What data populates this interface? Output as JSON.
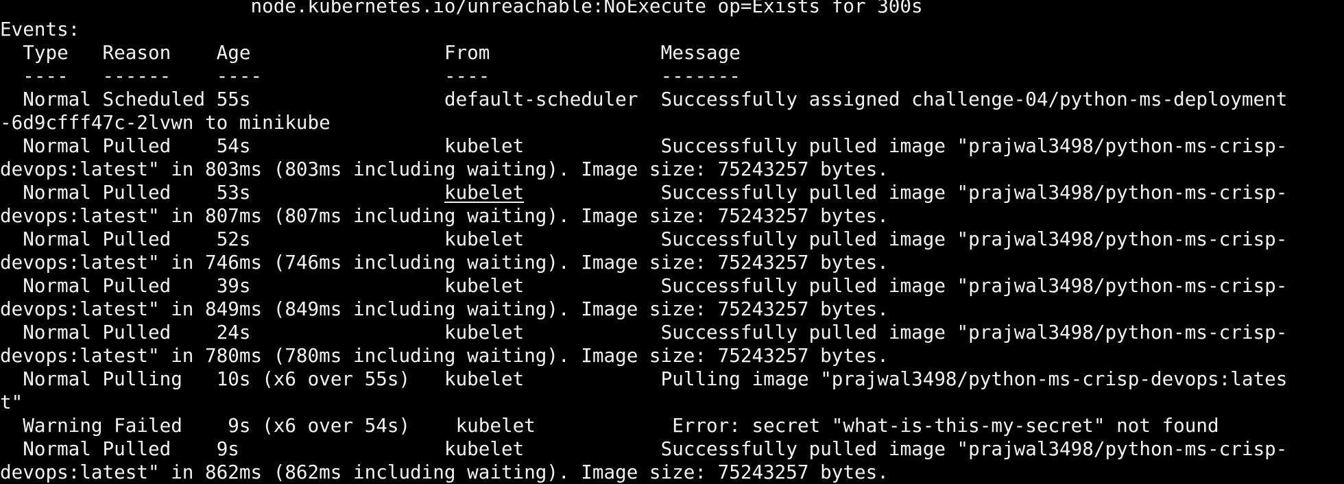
{
  "terminal": {
    "title_line": "                      node.kubernetes.io/unreachable:NoExecute op=Exists for 300s",
    "events_label": "Events:",
    "header": {
      "type": "Type",
      "reason": "Reason",
      "age": "Age",
      "from": "From",
      "message": "Message"
    },
    "separator": {
      "type": "----",
      "reason": "------",
      "age": "----",
      "from": "----",
      "message": "-------"
    },
    "events": [
      {
        "type": "Normal",
        "reason": "Scheduled",
        "age": "55s",
        "from": "default-scheduler",
        "message": "Successfully assigned challenge-04/python-ms-deployment",
        "message_cont": "-6d9cfff47c-2lvwn to minikube"
      },
      {
        "type": "Normal",
        "reason": "Pulled",
        "age": "54s",
        "from": "kubelet",
        "message": "Successfully pulled image \"prajwal3498/python-ms-crisp-",
        "message_cont": "devops:latest\" in 803ms (803ms including waiting). Image size: 75243257 bytes."
      },
      {
        "type": "Normal",
        "reason": "Pulled",
        "age": "53s",
        "from": "kubelet",
        "message": "Successfully pulled image \"prajwal3498/python-ms-crisp-",
        "message_cont": "devops:latest\" in 807ms (807ms including waiting). Image size: 75243257 bytes."
      },
      {
        "type": "Normal",
        "reason": "Pulled",
        "age": "52s",
        "from": "kubelet",
        "message": "Successfully pulled image \"prajwal3498/python-ms-crisp-",
        "message_cont": "devops:latest\" in 746ms (746ms including waiting). Image size: 75243257 bytes."
      },
      {
        "type": "Normal",
        "reason": "Pulled",
        "age": "39s",
        "from": "kubelet",
        "message": "Successfully pulled image \"prajwal3498/python-ms-crisp-",
        "message_cont": "devops:latest\" in 849ms (849ms including waiting). Image size: 75243257 bytes."
      },
      {
        "type": "Normal",
        "reason": "Pulled",
        "age": "24s",
        "from": "kubelet",
        "message": "Successfully pulled image \"prajwal3498/python-ms-crisp-",
        "message_cont": "devops:latest\" in 780ms (780ms including waiting). Image size: 75243257 bytes."
      },
      {
        "type": "Normal",
        "reason": "Pulling",
        "age": "10s (x6 over 55s)",
        "from": "kubelet",
        "message": "Pulling image \"prajwal3498/python-ms-crisp-devops:lates",
        "message_cont": "t\""
      },
      {
        "type": "Warning",
        "reason": "Failed",
        "age": "9s (x6 over 54s)",
        "from": "kubelet",
        "message": "Error: secret \"what-is-this-my-secret\" not found",
        "message_cont": null
      },
      {
        "type": "Normal",
        "reason": "Pulled",
        "age": "9s",
        "from": "kubelet",
        "message": "Successfully pulled image \"prajwal3498/python-ms-crisp-",
        "message_cont": "devops:latest\" in 862ms (862ms including waiting). Image size: 75243257 bytes."
      }
    ]
  }
}
